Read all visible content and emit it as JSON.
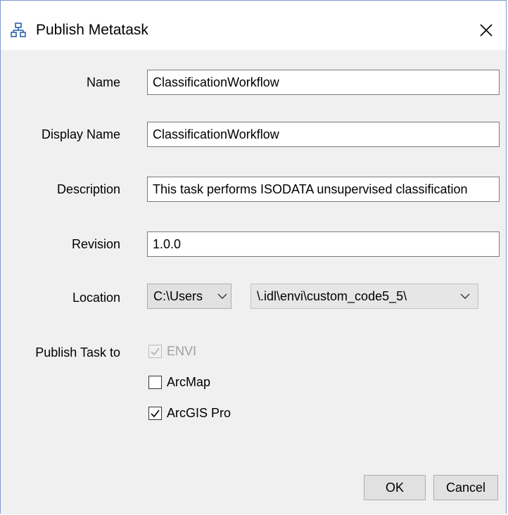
{
  "window": {
    "title": "Publish Metatask",
    "close_glyph": "✕"
  },
  "form": {
    "name_label": "Name",
    "name_value": "ClassificationWorkflow",
    "display_name_label": "Display Name",
    "display_name_value": "ClassificationWorkflow",
    "description_label": "Description",
    "description_value": "This task performs ISODATA unsupervised classification",
    "revision_label": "Revision",
    "revision_value": "1.0.0",
    "location_label": "Location",
    "location_root": "C:\\Users",
    "location_path": "\\.idl\\envi\\custom_code5_5\\",
    "publish_label": "Publish Task to"
  },
  "targets": [
    {
      "label": "ENVI",
      "checked": true,
      "disabled": true
    },
    {
      "label": "ArcMap",
      "checked": false,
      "disabled": false
    },
    {
      "label": "ArcGIS Pro",
      "checked": true,
      "disabled": false
    }
  ],
  "buttons": {
    "ok": "OK",
    "cancel": "Cancel"
  },
  "icons": {
    "title": "hierarchy-icon",
    "close": "close-icon",
    "dropdown": "chevron-down-icon",
    "check": "checkmark-icon"
  }
}
